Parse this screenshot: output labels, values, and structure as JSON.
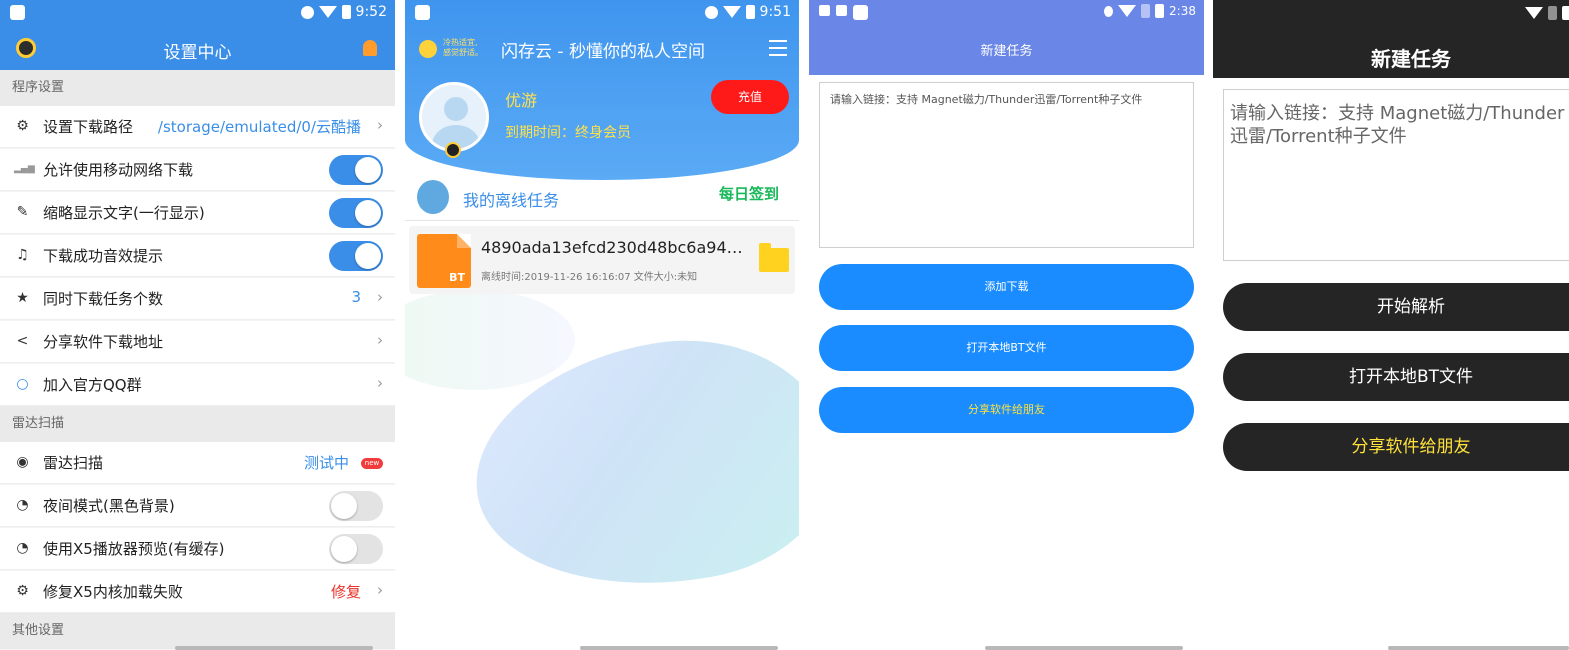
{
  "screens": {
    "settings": {
      "time": "9:52",
      "title": "设置中心",
      "sections": {
        "program": "程序设置",
        "radar": "雷达扫描",
        "other": "其他设置"
      },
      "rows": [
        {
          "label": "设置下载路径",
          "value": "/storage/emulated/0/云酷播",
          "icon": "gear-icon"
        },
        {
          "label": "允许使用移动网络下载",
          "toggle": "on",
          "icon": "signal-icon"
        },
        {
          "label": "缩略显示文字(一行显示)",
          "toggle": "on",
          "icon": "pencil-icon"
        },
        {
          "label": "下载成功音效提示",
          "toggle": "on",
          "icon": "sound-icon"
        },
        {
          "label": "同时下载任务个数",
          "value": "3",
          "icon": "star-icon"
        },
        {
          "label": "分享软件下载地址",
          "icon": "share-icon"
        },
        {
          "label": "加入官方QQ群",
          "icon": "qq-icon"
        },
        {
          "label": "雷达扫描",
          "value": "测试中",
          "badge": "new",
          "icon": "radar-icon"
        },
        {
          "label": "夜间模式(黑色背景)",
          "toggle": "off",
          "icon": "moon-icon"
        },
        {
          "label": "使用X5播放器预览(有缓存)",
          "toggle": "off",
          "icon": "clock-icon"
        },
        {
          "label": "修复X5内核加载失败",
          "value": "修复",
          "icon": "gear-icon"
        }
      ],
      "colors": {
        "accent": "#3a8ee8",
        "danger": "#e8302a"
      }
    },
    "cloud": {
      "time": "9:51",
      "weather": [
        "冷热适宜,",
        "感觉舒适。"
      ],
      "title": "闪存云 - 秒懂你的私人空间",
      "username": "优游",
      "recharge": "充值",
      "expire": "到期时间：终身会员",
      "tasks_title": "我的离线任务",
      "checkin": "每日签到",
      "task": {
        "icon_label": "BT",
        "name": "4890ada13efcd230d48bc6a942d1...",
        "meta": "离线时间:2019-11-26 16:16:07 文件大小:未知"
      }
    },
    "new_task_blue": {
      "time": "2:38",
      "title": "新建任务",
      "placeholder": "请输入链接：支持 Magnet磁力/Thunder迅雷/Torrent种子文件",
      "buttons": [
        "添加下载",
        "打开本地BT文件",
        "分享软件给朋友"
      ]
    },
    "new_task_dark": {
      "title": "新建任务",
      "placeholder": "请输入链接：支持 Magnet磁力/Thunder迅雷/Torrent种子文件",
      "buttons": [
        "开始解析",
        "打开本地BT文件",
        "分享软件给朋友"
      ]
    }
  }
}
